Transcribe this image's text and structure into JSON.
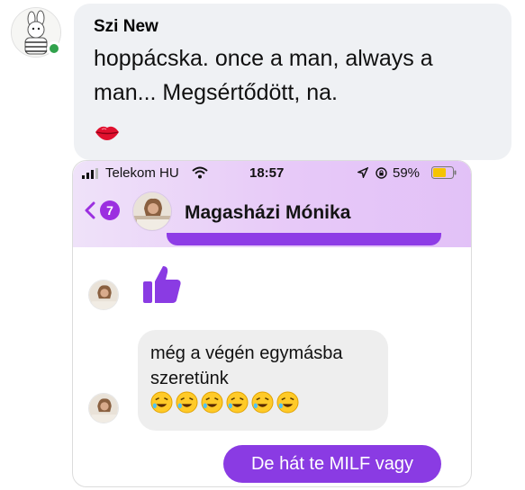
{
  "comment": {
    "author": "Szi New",
    "text": "hoppácska. once a man, always a man... Megsértődött, na.",
    "reaction_emoji": "lips-icon",
    "online_color": "#31a24c"
  },
  "screenshot": {
    "status_bar": {
      "carrier": "Telekom HU",
      "time": "18:57",
      "battery": "59%"
    },
    "header": {
      "unread_count": "7",
      "contact_name": "Magasházi Mónika"
    },
    "messages": [
      {
        "type": "like",
        "direction": "received",
        "icon": "thumbs-up-icon"
      },
      {
        "type": "text",
        "direction": "received",
        "text": "még a végén egymásba szeretünk",
        "emoji": "rofl-icon",
        "emoji_count": 6
      },
      {
        "type": "text",
        "direction": "sent",
        "text": "De hát te MILF vagy"
      }
    ],
    "accent_color": "#8a3be3"
  }
}
